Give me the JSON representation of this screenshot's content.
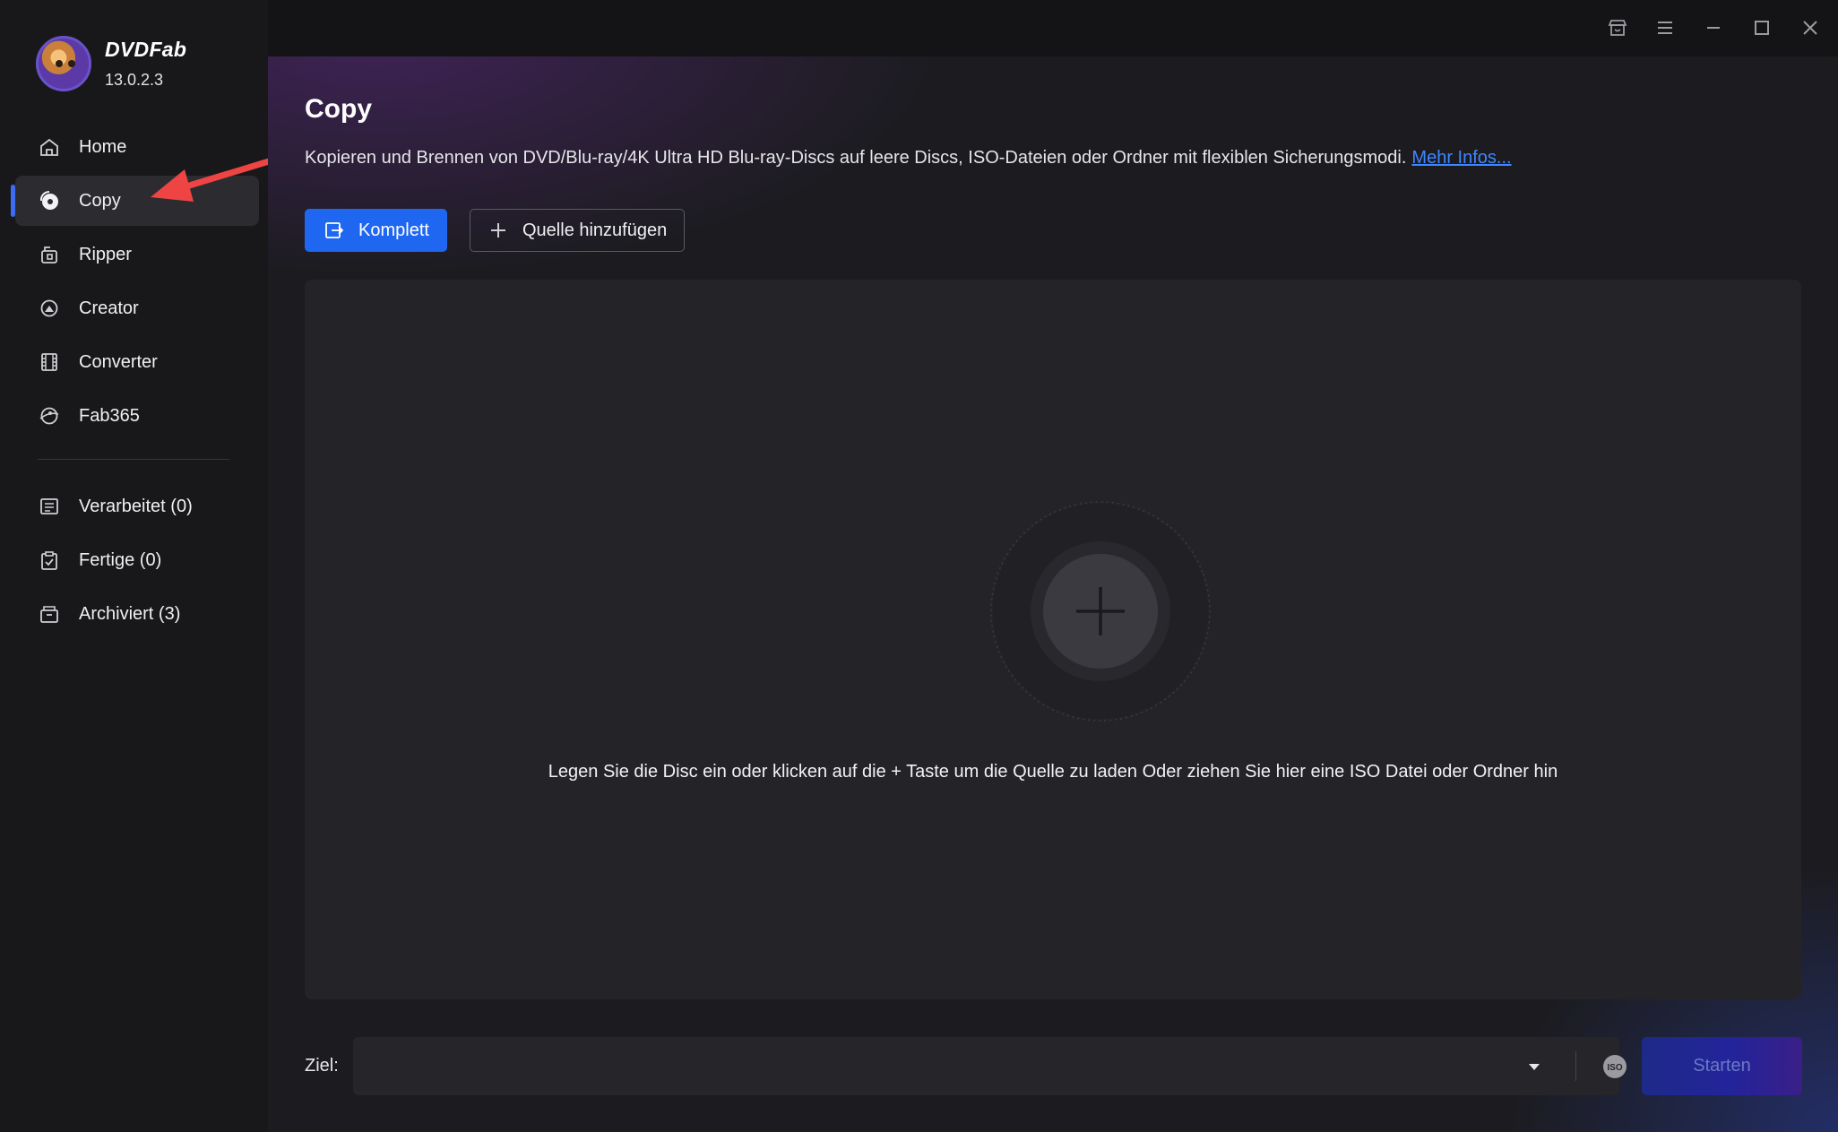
{
  "app": {
    "brand_name": "DVDFab",
    "version": "13.0.2.3"
  },
  "sidebar": {
    "items": [
      {
        "label": "Home",
        "icon": "home-icon"
      },
      {
        "label": "Copy",
        "icon": "copy-disc-icon",
        "active": true
      },
      {
        "label": "Ripper",
        "icon": "ripper-icon"
      },
      {
        "label": "Creator",
        "icon": "creator-icon"
      },
      {
        "label": "Converter",
        "icon": "converter-film-icon"
      },
      {
        "label": "Fab365",
        "icon": "fab365-icon"
      }
    ],
    "queue_items": [
      {
        "label": "Verarbeitet (0)",
        "icon": "processing-list-icon"
      },
      {
        "label": "Fertige (0)",
        "icon": "finished-clipboard-icon"
      },
      {
        "label": "Archiviert (3)",
        "icon": "archive-box-icon"
      }
    ]
  },
  "titlebar": {
    "icons": [
      "shop-icon",
      "menu-icon",
      "minimize-icon",
      "maximize-icon",
      "close-icon"
    ]
  },
  "main": {
    "title": "Copy",
    "description": "Kopieren und Brennen von DVD/Blu-ray/4K Ultra HD Blu-ray-Discs auf leere Discs, ISO-Dateien oder Ordner mit flexiblen Sicherungsmodi.",
    "more_info_link": "Mehr Infos...",
    "mode_button": "Komplett",
    "add_source_button": "Quelle hinzufügen",
    "dropzone_hint": "Legen Sie die Disc ein oder klicken auf die + Taste um die Quelle zu laden Oder ziehen Sie hier eine ISO Datei oder Ordner hin"
  },
  "footer": {
    "target_label": "Ziel:",
    "target_value": "",
    "start_button": "Starten"
  },
  "colors": {
    "accent_blue": "#1f67f0",
    "link_blue": "#3f86ff",
    "annotation_red": "#ef4444"
  }
}
